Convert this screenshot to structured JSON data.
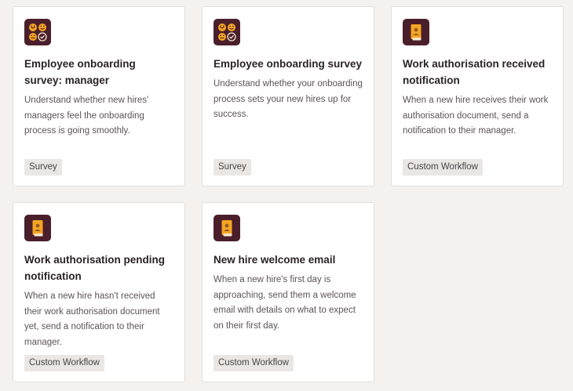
{
  "cards": [
    {
      "icon": "emoji-faces-icon",
      "title": "Employee onboarding survey: manager",
      "description": "Understand whether new hires' managers feel the onboarding process is going smoothly.",
      "tag": "Survey"
    },
    {
      "icon": "emoji-faces-icon",
      "title": "Employee onboarding survey",
      "description": "Understand whether your onboarding process sets your new hires up for success.",
      "tag": "Survey"
    },
    {
      "icon": "id-badge-icon",
      "title": "Work authorisation received notification",
      "description": "When a new hire receives their work authorisation document, send a notification to their manager.",
      "tag": "Custom Workflow"
    },
    {
      "icon": "id-badge-icon",
      "title": "Work authorisation pending notification",
      "description": "When a new hire hasn't received their work authorisation document yet, send a notification to their manager.",
      "tag": "Custom Workflow"
    },
    {
      "icon": "id-badge-icon",
      "title": "New hire welcome email",
      "description": "When a new hire's first day is approaching, send them a welcome email with details on what to expect on their first day.",
      "tag": "Custom Workflow"
    }
  ],
  "colors": {
    "background": "#f4f1ef",
    "icon_tile": "#4a1f2b",
    "icon_accent": "#f5a623",
    "tag_background": "#e9e6e4"
  }
}
